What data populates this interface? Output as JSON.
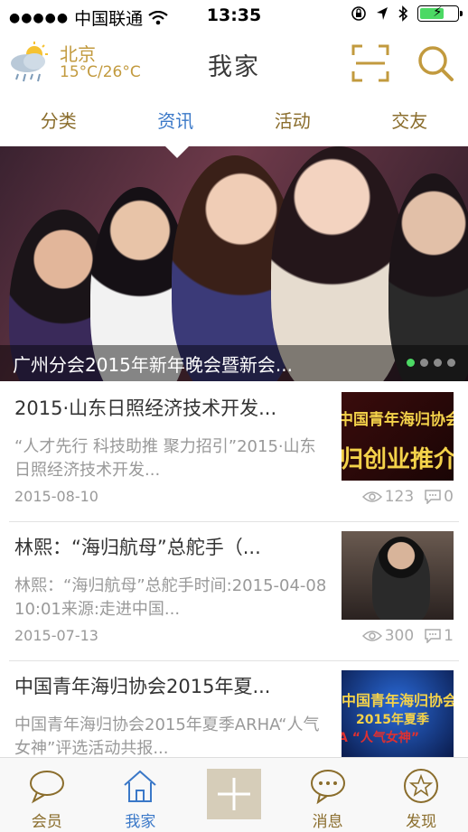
{
  "status_bar": {
    "carrier": "中国联通",
    "time": "13:35"
  },
  "header": {
    "city": "北京",
    "temperature": "15°C/26°C",
    "title": "我家",
    "weather_icon": "cloud-sun-rain-icon",
    "scan_icon": "scan-icon",
    "search_icon": "search-icon"
  },
  "tabs": [
    {
      "label": "分类",
      "active": false
    },
    {
      "label": "资讯",
      "active": true
    },
    {
      "label": "活动",
      "active": false
    },
    {
      "label": "交友",
      "active": false
    }
  ],
  "banner": {
    "caption": "广州分会2015年新年晚会暨新会...",
    "pages": 4,
    "current_page": 1
  },
  "news": [
    {
      "title": "2015·山东日照经济技术开发...",
      "summary": "“人才先行 科技助推 聚力招引”2015·山东日照经济技术开发...",
      "date": "2015-08-10",
      "views": "123",
      "comments": "0",
      "thumb_text_1": "中国青年海归协会",
      "thumb_text_2": "归创业推介"
    },
    {
      "title": "林熙：“海归航母”总舵手（...",
      "summary": "林熙：“海归航母”总舵手时间:2015-04-08 10:01来源:走进中国...",
      "date": "2015-07-13",
      "views": "300",
      "comments": "1"
    },
    {
      "title": "中国青年海归协会2015年夏...",
      "summary": "中国青年海归协会2015年夏季ARHA“人气女神”评选活动共报...",
      "thumb_text_1": "中国青年海归协会",
      "thumb_text_2": "2015年夏季",
      "thumb_text_3": "A “人气女神”"
    }
  ],
  "tab_bar": [
    {
      "label": "会员",
      "icon": "chat-bubble-icon",
      "active": false
    },
    {
      "label": "我家",
      "icon": "home-icon",
      "active": true
    },
    {
      "label": "",
      "icon": "plus-icon",
      "active": false
    },
    {
      "label": "消息",
      "icon": "message-icon",
      "active": false
    },
    {
      "label": "发现",
      "icon": "star-icon",
      "active": false
    }
  ],
  "colors": {
    "accent_gold": "#c29a3e",
    "active_blue": "#3a78c8",
    "battery_green": "#4cd964"
  }
}
